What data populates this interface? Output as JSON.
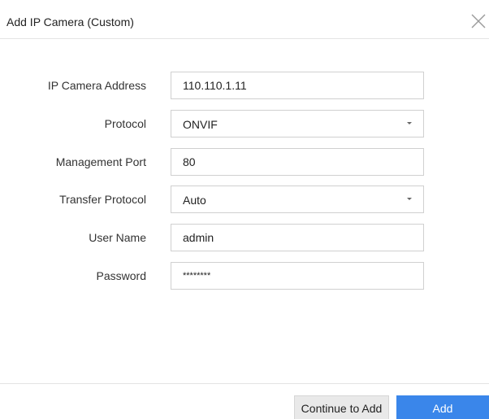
{
  "dialog": {
    "title": "Add IP Camera (Custom)",
    "close_icon": "close-icon"
  },
  "form": {
    "ip_address": {
      "label": "IP Camera Address",
      "value": "110.110.1.11"
    },
    "protocol": {
      "label": "Protocol",
      "value": "ONVIF",
      "icon": "chevron-down-icon"
    },
    "management_port": {
      "label": "Management Port",
      "value": "80"
    },
    "transfer_protocol": {
      "label": "Transfer Protocol",
      "value": "Auto",
      "icon": "chevron-down-icon"
    },
    "user_name": {
      "label": "User Name",
      "value": "admin"
    },
    "password": {
      "label": "Password",
      "value": "********"
    }
  },
  "footer": {
    "continue_label": "Continue to Add",
    "add_label": "Add"
  },
  "colors": {
    "primary": "#3a86ea",
    "secondary_button": "#e9e9e9",
    "border": "#d0d0d0"
  }
}
